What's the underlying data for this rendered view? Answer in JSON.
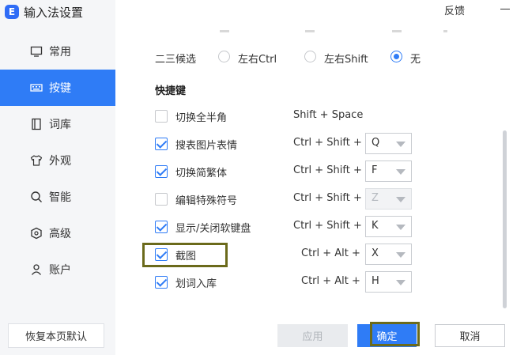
{
  "app": {
    "title": "输入法设置",
    "logo_text": "E"
  },
  "header": {
    "feedback": "反馈"
  },
  "sidebar": {
    "items": [
      {
        "label": "常用",
        "icon": "monitor-icon",
        "active": false
      },
      {
        "label": "按键",
        "icon": "keyboard-icon",
        "active": true
      },
      {
        "label": "词库",
        "icon": "book-icon",
        "active": false
      },
      {
        "label": "外观",
        "icon": "shirt-icon",
        "active": false
      },
      {
        "label": "智能",
        "icon": "search-icon",
        "active": false
      },
      {
        "label": "高级",
        "icon": "shield-icon",
        "active": false
      },
      {
        "label": "账户",
        "icon": "user-icon",
        "active": false
      }
    ],
    "restore_label": "恢复本页默认"
  },
  "candidate": {
    "label": "二三候选",
    "options": [
      {
        "label": "左右Ctrl",
        "selected": false
      },
      {
        "label": "左右Shift",
        "selected": false
      },
      {
        "label": "无",
        "selected": true
      }
    ]
  },
  "shortcuts": {
    "title": "快捷键",
    "rows": [
      {
        "label": "切换全半角",
        "checked": false,
        "combo": "Shift + Space",
        "key": null,
        "disabled": false
      },
      {
        "label": "搜表图片表情",
        "checked": true,
        "combo": "Ctrl + Shift +",
        "key": "Q",
        "disabled": false
      },
      {
        "label": "切换简繁体",
        "checked": true,
        "combo": "Ctrl + Shift +",
        "key": "F",
        "disabled": false
      },
      {
        "label": "编辑特殊符号",
        "checked": false,
        "combo": "Ctrl + Shift +",
        "key": "Z",
        "disabled": true
      },
      {
        "label": "显示/关闭软键盘",
        "checked": true,
        "combo": "Ctrl + Shift +",
        "key": "K",
        "disabled": false
      },
      {
        "label": "截图",
        "checked": true,
        "combo": "Ctrl + Alt +",
        "key": "X",
        "disabled": false
      },
      {
        "label": "划词入库",
        "checked": true,
        "combo": "Ctrl + Alt +",
        "key": "H",
        "disabled": false
      }
    ]
  },
  "footer": {
    "apply": "应用",
    "ok": "确定",
    "cancel": "取消"
  },
  "colors": {
    "accent": "#2f7cf6",
    "highlight": "#6b6a1b",
    "sidebar_bg": "#f5f6f8"
  }
}
